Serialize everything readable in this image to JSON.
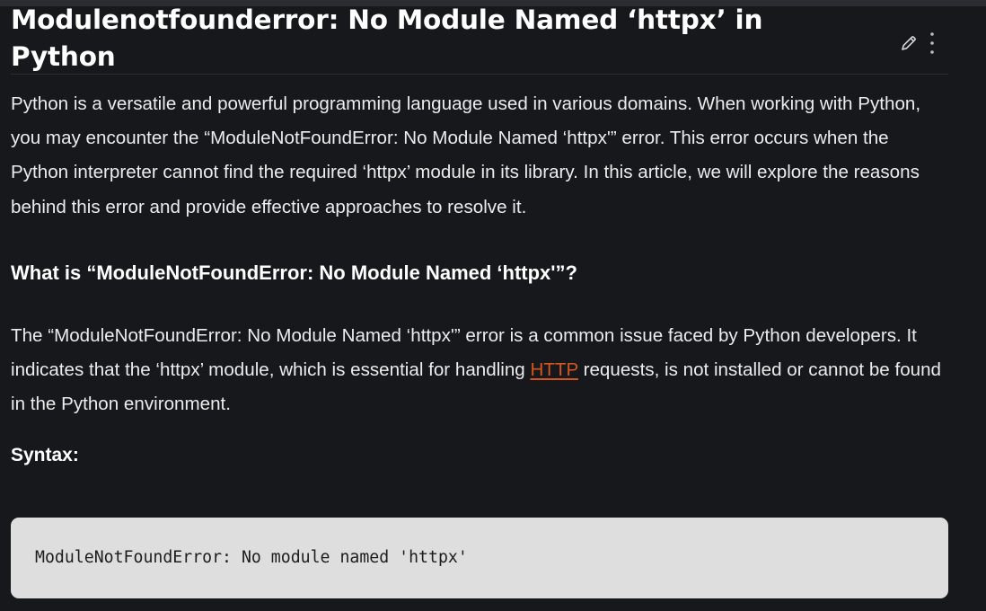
{
  "article": {
    "title": "Modulenotfounderror: No Module Named ‘httpx’ in Python",
    "intro": "Python is a versatile and powerful programming language used in various domains. When working with Python, you may encounter the “ModuleNotFoundError: No Module Named ‘httpx'” error. This error occurs when the Python interpreter cannot find the required ‘httpx’ module in its library. In this article, we will explore the reasons behind this error and provide effective approaches to resolve it.",
    "section_heading": "What is “ModuleNotFoundError: No Module Named ‘httpx'”?",
    "section_para_before_link": "The “ModuleNotFoundError: No Module Named ‘httpx'” error is a common issue faced by Python developers. It indicates that the ‘httpx’ module, which is essential for handling ",
    "section_link": "HTTP",
    "section_para_after_link": " requests, is not installed or cannot be found in the Python environment.",
    "syntax_label": "Syntax:",
    "code": "ModuleNotFoundError: No module named 'httpx'"
  },
  "icons": {
    "edit": "pencil-icon",
    "more": "more-vertical-icon"
  },
  "colors": {
    "background": "#17181c",
    "text": "#ececec",
    "link": "#d3561f",
    "code_background": "#dedede"
  }
}
